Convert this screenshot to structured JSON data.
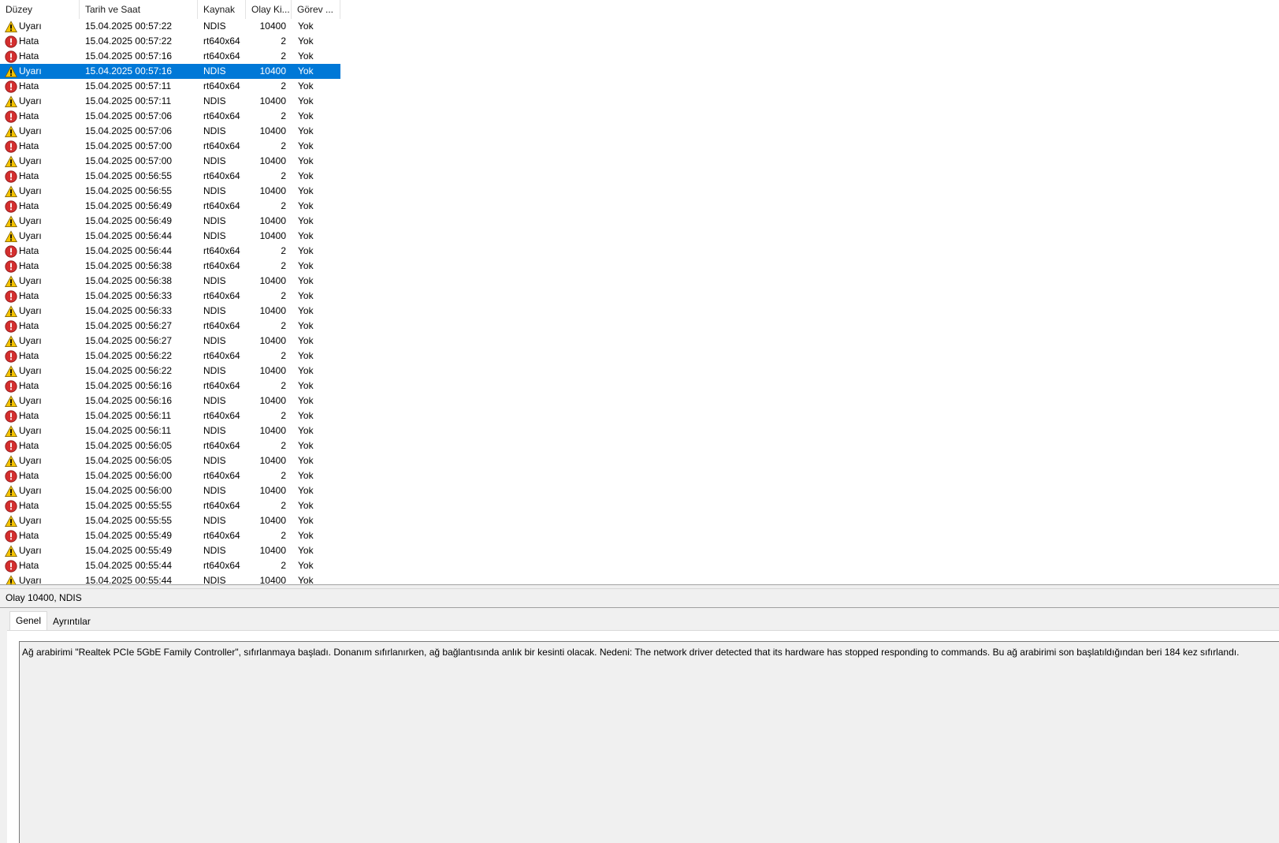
{
  "columns": {
    "level": "Düzey",
    "date": "Tarih ve Saat",
    "source": "Kaynak",
    "event_id": "Olay Ki...",
    "task": "Görev ..."
  },
  "rows": [
    {
      "level": "Uyarı",
      "type": "warning",
      "date": "15.04.2025 00:57:22",
      "source": "NDIS",
      "event_id": "10400",
      "task": "Yok"
    },
    {
      "level": "Hata",
      "type": "error",
      "date": "15.04.2025 00:57:22",
      "source": "rt640x64",
      "event_id": "2",
      "task": "Yok"
    },
    {
      "level": "Hata",
      "type": "error",
      "date": "15.04.2025 00:57:16",
      "source": "rt640x64",
      "event_id": "2",
      "task": "Yok"
    },
    {
      "level": "Uyarı",
      "type": "warning",
      "date": "15.04.2025 00:57:16",
      "source": "NDIS",
      "event_id": "10400",
      "task": "Yok",
      "selected": true
    },
    {
      "level": "Hata",
      "type": "error",
      "date": "15.04.2025 00:57:11",
      "source": "rt640x64",
      "event_id": "2",
      "task": "Yok"
    },
    {
      "level": "Uyarı",
      "type": "warning",
      "date": "15.04.2025 00:57:11",
      "source": "NDIS",
      "event_id": "10400",
      "task": "Yok"
    },
    {
      "level": "Hata",
      "type": "error",
      "date": "15.04.2025 00:57:06",
      "source": "rt640x64",
      "event_id": "2",
      "task": "Yok"
    },
    {
      "level": "Uyarı",
      "type": "warning",
      "date": "15.04.2025 00:57:06",
      "source": "NDIS",
      "event_id": "10400",
      "task": "Yok"
    },
    {
      "level": "Hata",
      "type": "error",
      "date": "15.04.2025 00:57:00",
      "source": "rt640x64",
      "event_id": "2",
      "task": "Yok"
    },
    {
      "level": "Uyarı",
      "type": "warning",
      "date": "15.04.2025 00:57:00",
      "source": "NDIS",
      "event_id": "10400",
      "task": "Yok"
    },
    {
      "level": "Hata",
      "type": "error",
      "date": "15.04.2025 00:56:55",
      "source": "rt640x64",
      "event_id": "2",
      "task": "Yok"
    },
    {
      "level": "Uyarı",
      "type": "warning",
      "date": "15.04.2025 00:56:55",
      "source": "NDIS",
      "event_id": "10400",
      "task": "Yok"
    },
    {
      "level": "Hata",
      "type": "error",
      "date": "15.04.2025 00:56:49",
      "source": "rt640x64",
      "event_id": "2",
      "task": "Yok"
    },
    {
      "level": "Uyarı",
      "type": "warning",
      "date": "15.04.2025 00:56:49",
      "source": "NDIS",
      "event_id": "10400",
      "task": "Yok"
    },
    {
      "level": "Uyarı",
      "type": "warning",
      "date": "15.04.2025 00:56:44",
      "source": "NDIS",
      "event_id": "10400",
      "task": "Yok"
    },
    {
      "level": "Hata",
      "type": "error",
      "date": "15.04.2025 00:56:44",
      "source": "rt640x64",
      "event_id": "2",
      "task": "Yok"
    },
    {
      "level": "Hata",
      "type": "error",
      "date": "15.04.2025 00:56:38",
      "source": "rt640x64",
      "event_id": "2",
      "task": "Yok"
    },
    {
      "level": "Uyarı",
      "type": "warning",
      "date": "15.04.2025 00:56:38",
      "source": "NDIS",
      "event_id": "10400",
      "task": "Yok"
    },
    {
      "level": "Hata",
      "type": "error",
      "date": "15.04.2025 00:56:33",
      "source": "rt640x64",
      "event_id": "2",
      "task": "Yok"
    },
    {
      "level": "Uyarı",
      "type": "warning",
      "date": "15.04.2025 00:56:33",
      "source": "NDIS",
      "event_id": "10400",
      "task": "Yok"
    },
    {
      "level": "Hata",
      "type": "error",
      "date": "15.04.2025 00:56:27",
      "source": "rt640x64",
      "event_id": "2",
      "task": "Yok"
    },
    {
      "level": "Uyarı",
      "type": "warning",
      "date": "15.04.2025 00:56:27",
      "source": "NDIS",
      "event_id": "10400",
      "task": "Yok"
    },
    {
      "level": "Hata",
      "type": "error",
      "date": "15.04.2025 00:56:22",
      "source": "rt640x64",
      "event_id": "2",
      "task": "Yok"
    },
    {
      "level": "Uyarı",
      "type": "warning",
      "date": "15.04.2025 00:56:22",
      "source": "NDIS",
      "event_id": "10400",
      "task": "Yok"
    },
    {
      "level": "Hata",
      "type": "error",
      "date": "15.04.2025 00:56:16",
      "source": "rt640x64",
      "event_id": "2",
      "task": "Yok"
    },
    {
      "level": "Uyarı",
      "type": "warning",
      "date": "15.04.2025 00:56:16",
      "source": "NDIS",
      "event_id": "10400",
      "task": "Yok"
    },
    {
      "level": "Hata",
      "type": "error",
      "date": "15.04.2025 00:56:11",
      "source": "rt640x64",
      "event_id": "2",
      "task": "Yok"
    },
    {
      "level": "Uyarı",
      "type": "warning",
      "date": "15.04.2025 00:56:11",
      "source": "NDIS",
      "event_id": "10400",
      "task": "Yok"
    },
    {
      "level": "Hata",
      "type": "error",
      "date": "15.04.2025 00:56:05",
      "source": "rt640x64",
      "event_id": "2",
      "task": "Yok"
    },
    {
      "level": "Uyarı",
      "type": "warning",
      "date": "15.04.2025 00:56:05",
      "source": "NDIS",
      "event_id": "10400",
      "task": "Yok"
    },
    {
      "level": "Hata",
      "type": "error",
      "date": "15.04.2025 00:56:00",
      "source": "rt640x64",
      "event_id": "2",
      "task": "Yok"
    },
    {
      "level": "Uyarı",
      "type": "warning",
      "date": "15.04.2025 00:56:00",
      "source": "NDIS",
      "event_id": "10400",
      "task": "Yok"
    },
    {
      "level": "Hata",
      "type": "error",
      "date": "15.04.2025 00:55:55",
      "source": "rt640x64",
      "event_id": "2",
      "task": "Yok"
    },
    {
      "level": "Uyarı",
      "type": "warning",
      "date": "15.04.2025 00:55:55",
      "source": "NDIS",
      "event_id": "10400",
      "task": "Yok"
    },
    {
      "level": "Hata",
      "type": "error",
      "date": "15.04.2025 00:55:49",
      "source": "rt640x64",
      "event_id": "2",
      "task": "Yok"
    },
    {
      "level": "Uyarı",
      "type": "warning",
      "date": "15.04.2025 00:55:49",
      "source": "NDIS",
      "event_id": "10400",
      "task": "Yok"
    },
    {
      "level": "Hata",
      "type": "error",
      "date": "15.04.2025 00:55:44",
      "source": "rt640x64",
      "event_id": "2",
      "task": "Yok"
    },
    {
      "level": "Uyarı",
      "type": "warning",
      "date": "15.04.2025 00:55:44",
      "source": "NDIS",
      "event_id": "10400",
      "task": "Yok"
    }
  ],
  "detail": {
    "title": "Olay 10400, NDIS",
    "tabs": [
      "Genel",
      "Ayrıntılar"
    ],
    "active_tab": "Genel",
    "description": "Ağ arabirimi \"Realtek PCIe 5GbE Family Controller\", sıfırlanmaya başladı. Donanım sıfırlanırken, ağ bağlantısında anlık bir kesinti olacak. Nedeni: The network driver detected that its hardware has stopped responding to commands. Bu ağ arabirimi son başlatıldığından beri 184 kez sıfırlandı."
  },
  "colors": {
    "selection": "#0078d7",
    "warning": "#f5c400",
    "error": "#d32f2f"
  },
  "icons": {
    "warning": "warning-icon",
    "error": "error-icon"
  }
}
